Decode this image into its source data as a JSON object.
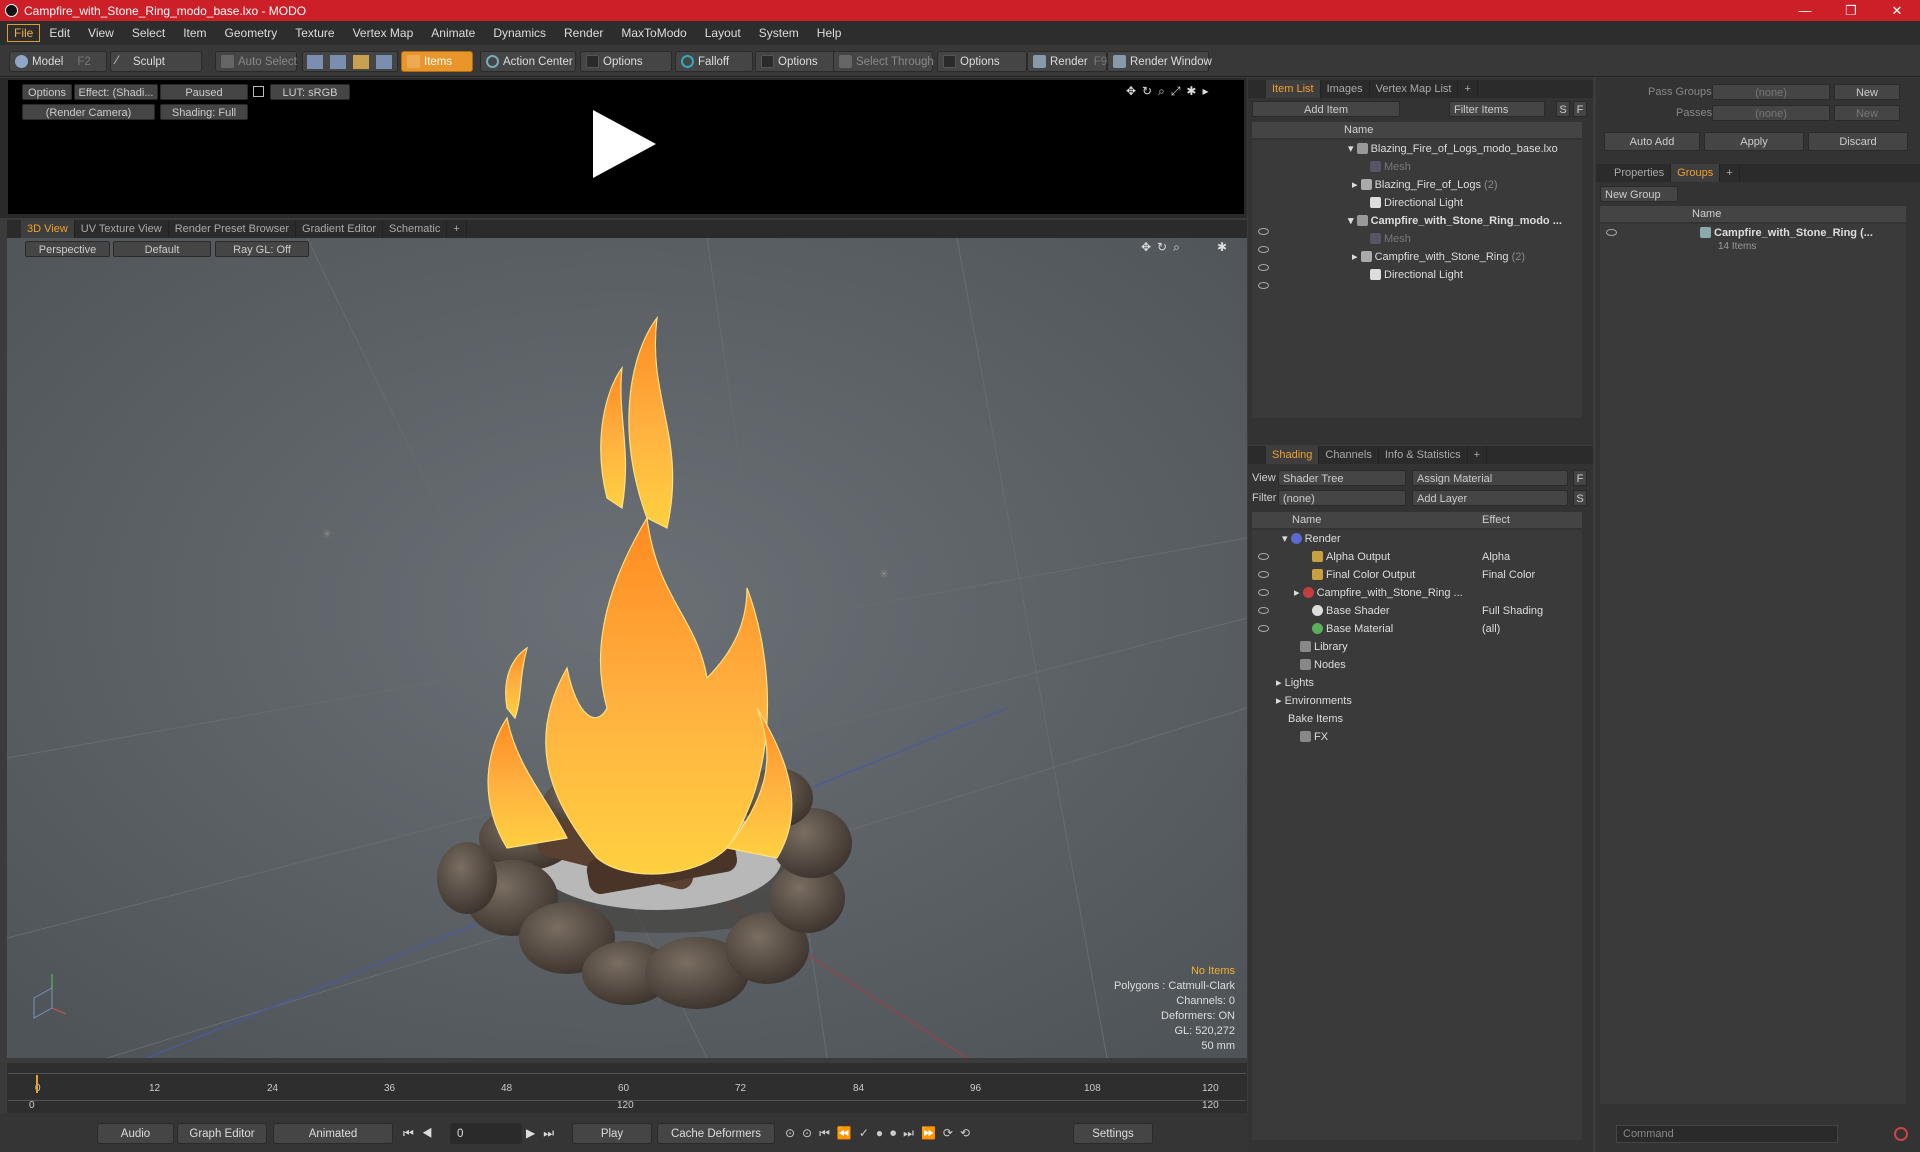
{
  "window": {
    "title": "Campfire_with_Stone_Ring_modo_base.lxo - MODO",
    "minimize": "—",
    "maximize": "❐",
    "close": "✕"
  },
  "menu": [
    "File",
    "Edit",
    "View",
    "Select",
    "Item",
    "Geometry",
    "Texture",
    "Vertex Map",
    "Animate",
    "Dynamics",
    "Render",
    "MaxToModo",
    "Layout",
    "System",
    "Help"
  ],
  "toolbar": {
    "model": "Model",
    "model_key": "F2",
    "sculpt": "Sculpt",
    "auto_select": "Auto Select",
    "items": "Items",
    "action_center": "Action Center",
    "options1": "Options",
    "falloff": "Falloff",
    "options2": "Options",
    "select_through": "Select Through",
    "options3": "Options",
    "render": "Render",
    "render_key": "F9",
    "render_window": "Render Window"
  },
  "preview": {
    "options": "Options",
    "effect": "Effect: (Shadi...",
    "paused": "Paused",
    "lut": "LUT: sRGB",
    "camera": "(Render Camera)",
    "shading": "Shading: Full"
  },
  "viewport_tabs": [
    "3D View",
    "UV Texture View",
    "Render Preset Browser",
    "Gradient Editor",
    "Schematic",
    "+"
  ],
  "viewport": {
    "perspective": "Perspective",
    "default": "Default",
    "raygl": "Ray GL: Off"
  },
  "hud": {
    "no_items": "No Items",
    "polygons": "Polygons : Catmull-Clark",
    "channels": "Channels: 0",
    "deformers": "Deformers: ON",
    "gl": "GL: 520,272",
    "lens": "50 mm"
  },
  "timeline": {
    "ticks": [
      "0",
      "12",
      "24",
      "36",
      "48",
      "60",
      "72",
      "84",
      "96",
      "108",
      "120"
    ],
    "start": "0",
    "mid": "120",
    "end": "120"
  },
  "bottom": {
    "audio": "Audio",
    "graph_editor": "Graph Editor",
    "animated": "Animated",
    "frame": "0",
    "play": "Play",
    "cache": "Cache Deformers",
    "settings": "Settings"
  },
  "item_list": {
    "tabs": [
      "Item List",
      "Images",
      "Vertex Map List",
      "+"
    ],
    "add_item": "Add Item",
    "filter": "Filter Items",
    "s": "S",
    "f": "F",
    "col_name": "Name",
    "rows": [
      {
        "label": "Blazing_Fire_of_Logs_modo_base.lxo",
        "count": ""
      },
      {
        "label": "Mesh",
        "count": ""
      },
      {
        "label": "Blazing_Fire_of_Logs",
        "count": "(2)"
      },
      {
        "label": "Directional Light",
        "count": ""
      },
      {
        "label": "Campfire_with_Stone_Ring_modo ...",
        "count": ""
      },
      {
        "label": "Mesh",
        "count": ""
      },
      {
        "label": "Campfire_with_Stone_Ring",
        "count": "(2)"
      },
      {
        "label": "Directional Light",
        "count": ""
      }
    ]
  },
  "shading": {
    "tabs": [
      "Shading",
      "Channels",
      "Info & Statistics",
      "+"
    ],
    "view_label": "View",
    "view_value": "Shader Tree",
    "assign": "Assign Material",
    "f": "F",
    "filter_label": "Filter",
    "filter_value": "(none)",
    "add_layer": "Add Layer",
    "s": "S",
    "col_name": "Name",
    "col_effect": "Effect",
    "rows": [
      {
        "name": "Render",
        "effect": ""
      },
      {
        "name": "Alpha Output",
        "effect": "Alpha"
      },
      {
        "name": "Final Color Output",
        "effect": "Final Color"
      },
      {
        "name": "Campfire_with_Stone_Ring ...",
        "effect": ""
      },
      {
        "name": "Base Shader",
        "effect": "Full Shading"
      },
      {
        "name": "Base Material",
        "effect": "(all)"
      },
      {
        "name": "Library",
        "effect": ""
      },
      {
        "name": "Nodes",
        "effect": ""
      },
      {
        "name": "Lights",
        "effect": ""
      },
      {
        "name": "Environments",
        "effect": ""
      },
      {
        "name": "Bake Items",
        "effect": ""
      },
      {
        "name": "FX",
        "effect": ""
      }
    ]
  },
  "groups_panel": {
    "pass_groups": "Pass Groups",
    "pass_groups_value": "(none)",
    "new": "New",
    "passes": "Passes",
    "passes_value": "(none)",
    "new2": "New",
    "auto_add": "Auto Add",
    "apply": "Apply",
    "discard": "Discard",
    "tabs": [
      "Properties",
      "Groups",
      "+"
    ],
    "new_group": "New Group",
    "col_name": "Name",
    "group_name": "Campfire_with_Stone_Ring (...",
    "group_count": "14 Items",
    "command": "Command"
  }
}
